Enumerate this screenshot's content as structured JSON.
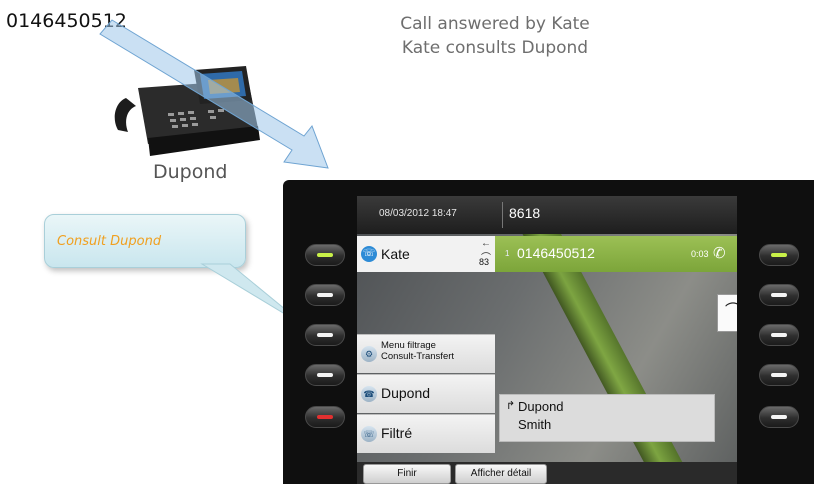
{
  "header": {
    "phone_number": "0146450512",
    "caption_line1": "Call answered by Kate",
    "caption_line2": "Kate consults Dupond",
    "desk_phone_label": "Dupond"
  },
  "callout": {
    "text": "Consult Dupond"
  },
  "screen": {
    "status": {
      "date": "08/03/2012 18:47",
      "extension": "8618"
    },
    "line": {
      "label": "Kate",
      "count": "83"
    },
    "active_call": {
      "index": "1",
      "number": "0146450512",
      "duration": "0:03"
    },
    "menu_rows": {
      "menu_line1": "Menu filtrage",
      "menu_line2": "Consult-Transfert",
      "dupond": "Dupond",
      "filtre": "Filtré"
    },
    "call_info": {
      "name": "Dupond",
      "surname": "Smith"
    },
    "softkeys": {
      "finir": "Finir",
      "detail": "Afficher détail"
    }
  },
  "colors": {
    "active_call_green": "#8bb446",
    "callout_text": "#f0a020",
    "caption_gray": "#6e6e6e"
  }
}
